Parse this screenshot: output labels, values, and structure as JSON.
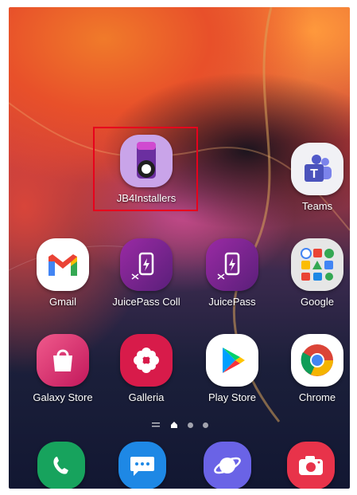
{
  "home": {
    "apps": [
      {
        "label": "JB4Installers",
        "icon": "jb4installers-icon",
        "color": "#c9a4e9"
      },
      {
        "label": "Teams",
        "icon": "teams-icon",
        "color": "#f1f1f5"
      },
      {
        "label": "Gmail",
        "icon": "gmail-icon",
        "color": "#ffffff"
      },
      {
        "label": "JuicePass Coll",
        "icon": "juicepass-icon",
        "color": "#7a2a8f"
      },
      {
        "label": "JuicePass",
        "icon": "juicepass-icon",
        "color": "#7a2a8f"
      },
      {
        "label": "Google",
        "icon": "google-folder-icon",
        "color": "#e6e6e6"
      },
      {
        "label": "Galaxy Store",
        "icon": "galaxy-store-icon",
        "color": "#e6337a"
      },
      {
        "label": "Galleria",
        "icon": "gallery-icon",
        "color": "#d81b4a"
      },
      {
        "label": "Play Store",
        "icon": "play-store-icon",
        "color": "#ffffff"
      },
      {
        "label": "Chrome",
        "icon": "chrome-icon",
        "color": "#ffffff"
      }
    ],
    "highlighted_app": "JB4Installers"
  },
  "page_indicator": {
    "pages": 3,
    "current": 1
  },
  "dock": [
    {
      "icon": "phone-icon",
      "color": "#17a35d"
    },
    {
      "icon": "messages-icon",
      "color": "#1e88e5"
    },
    {
      "icon": "internet-icon",
      "color": "#6a63e6"
    },
    {
      "icon": "camera-icon",
      "color": "#e8334a"
    }
  ]
}
